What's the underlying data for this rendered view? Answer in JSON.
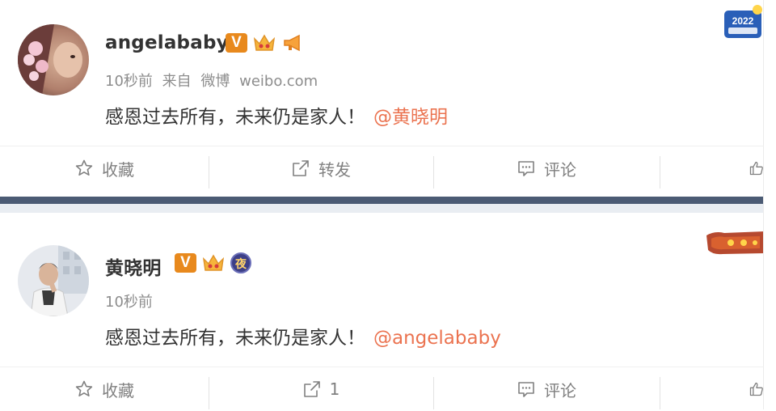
{
  "posts": [
    {
      "username": "angelababy",
      "v_badge": "V",
      "time": "10秒前",
      "source_prefix": "来自",
      "source_app": "微博",
      "source_url": "weibo.com",
      "text": "感恩过去所有，未来仍是家人！",
      "mention": "@黄晓明",
      "actions": {
        "favorite": "收藏",
        "repost": "转发",
        "comment": "评论"
      },
      "corner_badge_text": "2022"
    },
    {
      "username": "黄晓明",
      "v_badge": "V",
      "night_badge": "夜",
      "time": "10秒前",
      "text": "感恩过去所有，未来仍是家人！",
      "mention": "@angelababy",
      "actions": {
        "favorite": "收藏",
        "repost": "1",
        "comment": "评论"
      }
    }
  ],
  "colors": {
    "accent": "#eb7350",
    "v_badge": "#e8891d",
    "divider_strip": "#4b5b74",
    "text": "#333333",
    "meta": "#8d8d8d"
  }
}
